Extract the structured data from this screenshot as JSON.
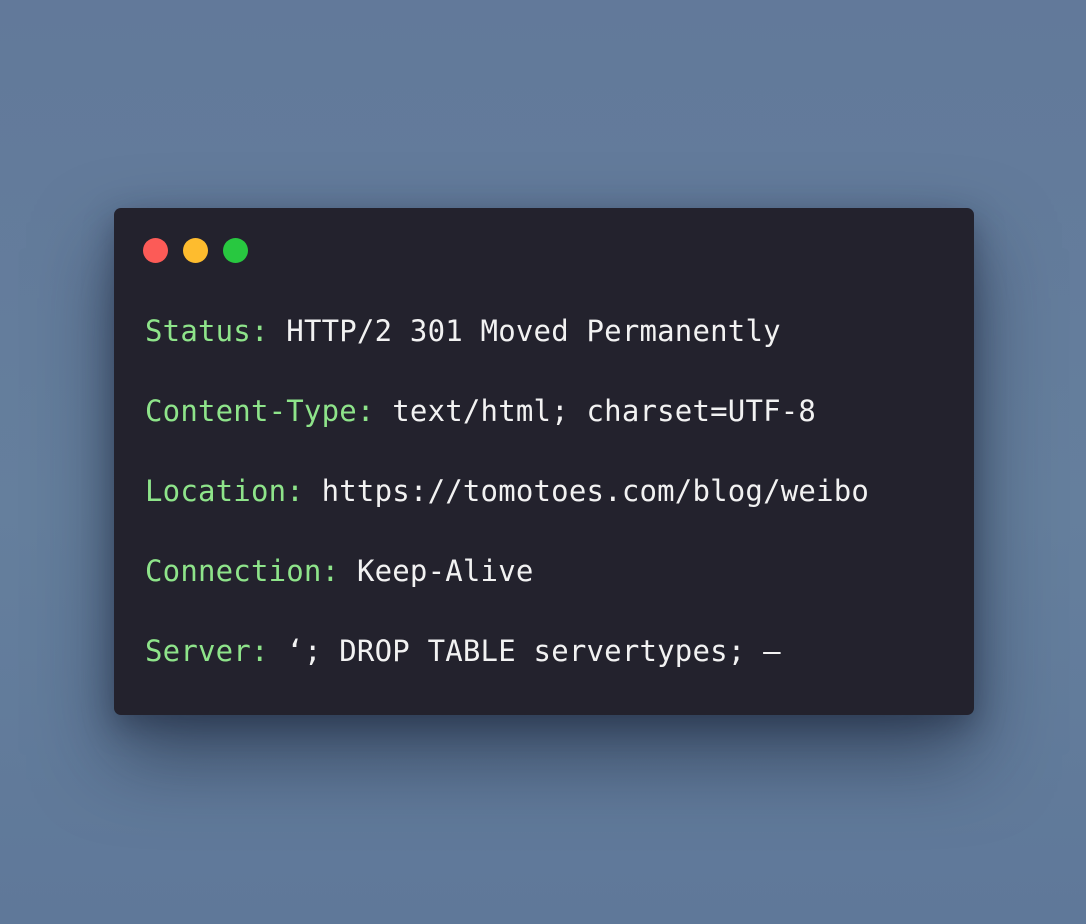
{
  "colors": {
    "background": "#647e9c",
    "window": "#23222d",
    "key": "#8ee48a",
    "value": "#f2f2f2",
    "close": "#fc5b57",
    "minimize": "#febc2e",
    "zoom": "#28c840"
  },
  "window": {
    "controls": [
      {
        "name": "close",
        "color": "#fc5b57"
      },
      {
        "name": "minimize",
        "color": "#febc2e"
      },
      {
        "name": "zoom",
        "color": "#28c840"
      }
    ]
  },
  "headers": [
    {
      "key": "Status:",
      "value": "HTTP/2 301 Moved Permanently"
    },
    {
      "key": "Content-Type:",
      "value": "text/html; charset=UTF-8"
    },
    {
      "key": "Location:",
      "value": "https://tomotoes.com/blog/weibo"
    },
    {
      "key": "Connection:",
      "value": "Keep-Alive"
    },
    {
      "key": "Server:",
      "value": "‘; DROP TABLE servertypes; —"
    }
  ]
}
